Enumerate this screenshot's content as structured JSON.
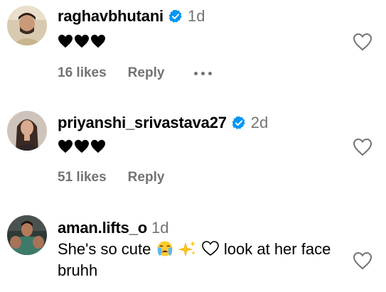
{
  "comments": [
    {
      "username": "raghavbhutani",
      "verified": true,
      "timestamp": "1d",
      "text_icons": [
        "black-heart-icon",
        "black-heart-icon",
        "black-heart-icon"
      ],
      "likes": "16 likes",
      "reply": "Reply",
      "show_more_menu": true
    },
    {
      "username": "priyanshi_srivastava27",
      "verified": true,
      "timestamp": "2d",
      "text_icons": [
        "black-heart-icon",
        "black-heart-icon",
        "black-heart-icon"
      ],
      "likes": "51 likes",
      "reply": "Reply"
    },
    {
      "username": "aman.lifts_o",
      "verified": false,
      "timestamp": "1d",
      "text_part1": "She's so cute",
      "text_icons": [
        "crying-face-icon",
        "sparkles-icon",
        "white-heart-icon"
      ],
      "text_part2": "look at her face bruhh"
    }
  ],
  "colors": {
    "verified_blue": "#0095f6",
    "muted_gray": "#737373",
    "text_black": "#000000"
  }
}
